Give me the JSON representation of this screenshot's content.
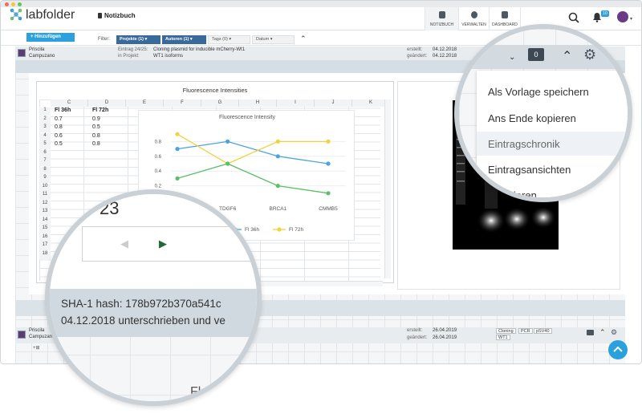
{
  "app": {
    "name": "labfolder",
    "notebook": "Notizbuch",
    "notifications": "10"
  },
  "nav": [
    {
      "label": "NOTIZBUCH"
    },
    {
      "label": "VERWALTEN"
    },
    {
      "label": "DASHBOARD"
    }
  ],
  "filter": {
    "add_label": "Hinzufügen",
    "label": "Filter:",
    "chips": [
      {
        "label": "Projekte (1)"
      },
      {
        "label": "Autoren (1)"
      },
      {
        "label": "Tags (0)"
      },
      {
        "label": "Datum"
      }
    ]
  },
  "entry1": {
    "author_first": "Priscila",
    "author_last": "Campuzano",
    "entry_label": "Eintrag 24/25:",
    "entry_title": "Cloning plasmid for inducible mCherry-Wt1",
    "project_label": "in Projekt:",
    "project": "WT1 isoforms",
    "created_label": "erstellt:",
    "created": "04.12.2018",
    "changed_label": "geändert:",
    "changed": "04.12.2018"
  },
  "spreadsheet": {
    "title": "Fluorescence Intensities",
    "columns": [
      "C",
      "D",
      "E",
      "F",
      "G",
      "H",
      "I",
      "J",
      "K"
    ],
    "rows": [
      "1",
      "2",
      "3",
      "4",
      "5",
      "6",
      "7",
      "8",
      "9",
      "10",
      "11",
      "12",
      "13",
      "14",
      "15",
      "16",
      "17",
      "18"
    ],
    "col_c": [
      "Fl 36h",
      "0.7",
      "0.8",
      "0.6",
      "0.5"
    ],
    "col_d": [
      "Fl 72h",
      "0.9",
      "0.5",
      "0.8",
      "0.8"
    ]
  },
  "chart_data": {
    "type": "line",
    "title": "Fluorescence Intensity",
    "categories": [
      "TDGF6",
      "BRCA1",
      "CMMB5"
    ],
    "ylim": [
      0,
      1
    ],
    "yticks": [
      "0.2",
      "0.4",
      "0.6",
      "0.8"
    ],
    "series": [
      {
        "name": "Fl 36h",
        "color": "#4aa3df",
        "values": [
          0.7,
          0.8,
          0.6,
          0.5
        ]
      },
      {
        "name": "Fl 72h",
        "color": "#f2d33c",
        "values": [
          0.9,
          0.5,
          0.8,
          0.8
        ]
      },
      {
        "name": "",
        "color": "#5cbf6a",
        "values": [
          0.3,
          0.5,
          0.2,
          0.1
        ]
      }
    ]
  },
  "gel_panel": {
    "title": "Re"
  },
  "menu": {
    "items": [
      {
        "label": "Als Vorlage speichern"
      },
      {
        "label": "Ans Ende kopieren"
      },
      {
        "label": "Eintragschronik"
      },
      {
        "label": "Eintragsansichten"
      },
      {
        "label": "rtieren"
      }
    ],
    "comments": "0"
  },
  "signature": {
    "hash": "SHA-1 hash: 178b972b370a541c",
    "signed": "04.12.2018 unterschrieben und ve"
  },
  "entry2": {
    "author_first": "Priscila",
    "author_last": "Campuzano",
    "created_label": "erstellt:",
    "created": "26.04.2019",
    "changed_label": "geändert:",
    "changed": "26.04.2019",
    "tags": [
      "Cloning",
      "PCR",
      "pSV40",
      "WT1"
    ]
  },
  "magnifier": {
    "cell": "23",
    "bottom_left": "ila",
    "bottom_right": "Fl"
  }
}
